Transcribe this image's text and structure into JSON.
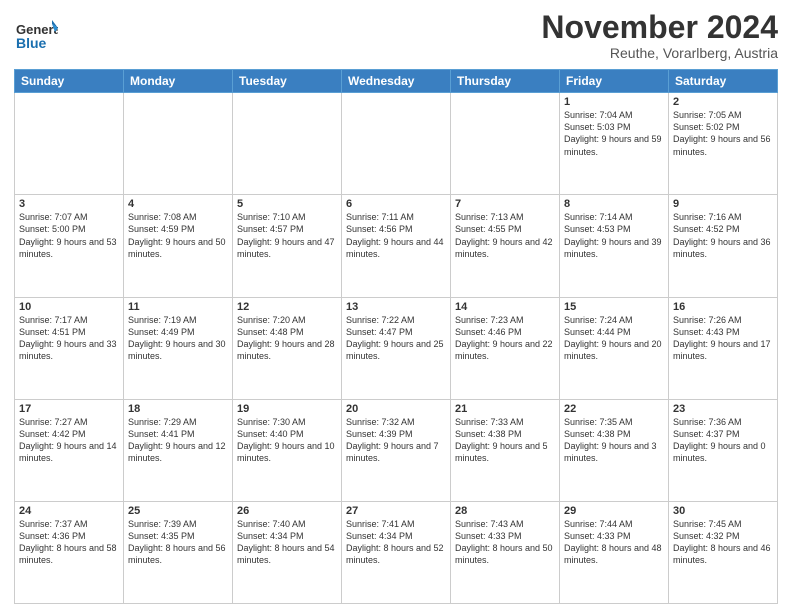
{
  "logo": {
    "text_general": "General",
    "text_blue": "Blue"
  },
  "header": {
    "month_title": "November 2024",
    "subtitle": "Reuthe, Vorarlberg, Austria"
  },
  "weekdays": [
    "Sunday",
    "Monday",
    "Tuesday",
    "Wednesday",
    "Thursday",
    "Friday",
    "Saturday"
  ],
  "weeks": [
    [
      {
        "day": "",
        "info": ""
      },
      {
        "day": "",
        "info": ""
      },
      {
        "day": "",
        "info": ""
      },
      {
        "day": "",
        "info": ""
      },
      {
        "day": "",
        "info": ""
      },
      {
        "day": "1",
        "info": "Sunrise: 7:04 AM\nSunset: 5:03 PM\nDaylight: 9 hours and 59 minutes."
      },
      {
        "day": "2",
        "info": "Sunrise: 7:05 AM\nSunset: 5:02 PM\nDaylight: 9 hours and 56 minutes."
      }
    ],
    [
      {
        "day": "3",
        "info": "Sunrise: 7:07 AM\nSunset: 5:00 PM\nDaylight: 9 hours and 53 minutes."
      },
      {
        "day": "4",
        "info": "Sunrise: 7:08 AM\nSunset: 4:59 PM\nDaylight: 9 hours and 50 minutes."
      },
      {
        "day": "5",
        "info": "Sunrise: 7:10 AM\nSunset: 4:57 PM\nDaylight: 9 hours and 47 minutes."
      },
      {
        "day": "6",
        "info": "Sunrise: 7:11 AM\nSunset: 4:56 PM\nDaylight: 9 hours and 44 minutes."
      },
      {
        "day": "7",
        "info": "Sunrise: 7:13 AM\nSunset: 4:55 PM\nDaylight: 9 hours and 42 minutes."
      },
      {
        "day": "8",
        "info": "Sunrise: 7:14 AM\nSunset: 4:53 PM\nDaylight: 9 hours and 39 minutes."
      },
      {
        "day": "9",
        "info": "Sunrise: 7:16 AM\nSunset: 4:52 PM\nDaylight: 9 hours and 36 minutes."
      }
    ],
    [
      {
        "day": "10",
        "info": "Sunrise: 7:17 AM\nSunset: 4:51 PM\nDaylight: 9 hours and 33 minutes."
      },
      {
        "day": "11",
        "info": "Sunrise: 7:19 AM\nSunset: 4:49 PM\nDaylight: 9 hours and 30 minutes."
      },
      {
        "day": "12",
        "info": "Sunrise: 7:20 AM\nSunset: 4:48 PM\nDaylight: 9 hours and 28 minutes."
      },
      {
        "day": "13",
        "info": "Sunrise: 7:22 AM\nSunset: 4:47 PM\nDaylight: 9 hours and 25 minutes."
      },
      {
        "day": "14",
        "info": "Sunrise: 7:23 AM\nSunset: 4:46 PM\nDaylight: 9 hours and 22 minutes."
      },
      {
        "day": "15",
        "info": "Sunrise: 7:24 AM\nSunset: 4:44 PM\nDaylight: 9 hours and 20 minutes."
      },
      {
        "day": "16",
        "info": "Sunrise: 7:26 AM\nSunset: 4:43 PM\nDaylight: 9 hours and 17 minutes."
      }
    ],
    [
      {
        "day": "17",
        "info": "Sunrise: 7:27 AM\nSunset: 4:42 PM\nDaylight: 9 hours and 14 minutes."
      },
      {
        "day": "18",
        "info": "Sunrise: 7:29 AM\nSunset: 4:41 PM\nDaylight: 9 hours and 12 minutes."
      },
      {
        "day": "19",
        "info": "Sunrise: 7:30 AM\nSunset: 4:40 PM\nDaylight: 9 hours and 10 minutes."
      },
      {
        "day": "20",
        "info": "Sunrise: 7:32 AM\nSunset: 4:39 PM\nDaylight: 9 hours and 7 minutes."
      },
      {
        "day": "21",
        "info": "Sunrise: 7:33 AM\nSunset: 4:38 PM\nDaylight: 9 hours and 5 minutes."
      },
      {
        "day": "22",
        "info": "Sunrise: 7:35 AM\nSunset: 4:38 PM\nDaylight: 9 hours and 3 minutes."
      },
      {
        "day": "23",
        "info": "Sunrise: 7:36 AM\nSunset: 4:37 PM\nDaylight: 9 hours and 0 minutes."
      }
    ],
    [
      {
        "day": "24",
        "info": "Sunrise: 7:37 AM\nSunset: 4:36 PM\nDaylight: 8 hours and 58 minutes."
      },
      {
        "day": "25",
        "info": "Sunrise: 7:39 AM\nSunset: 4:35 PM\nDaylight: 8 hours and 56 minutes."
      },
      {
        "day": "26",
        "info": "Sunrise: 7:40 AM\nSunset: 4:34 PM\nDaylight: 8 hours and 54 minutes."
      },
      {
        "day": "27",
        "info": "Sunrise: 7:41 AM\nSunset: 4:34 PM\nDaylight: 8 hours and 52 minutes."
      },
      {
        "day": "28",
        "info": "Sunrise: 7:43 AM\nSunset: 4:33 PM\nDaylight: 8 hours and 50 minutes."
      },
      {
        "day": "29",
        "info": "Sunrise: 7:44 AM\nSunset: 4:33 PM\nDaylight: 8 hours and 48 minutes."
      },
      {
        "day": "30",
        "info": "Sunrise: 7:45 AM\nSunset: 4:32 PM\nDaylight: 8 hours and 46 minutes."
      }
    ]
  ]
}
